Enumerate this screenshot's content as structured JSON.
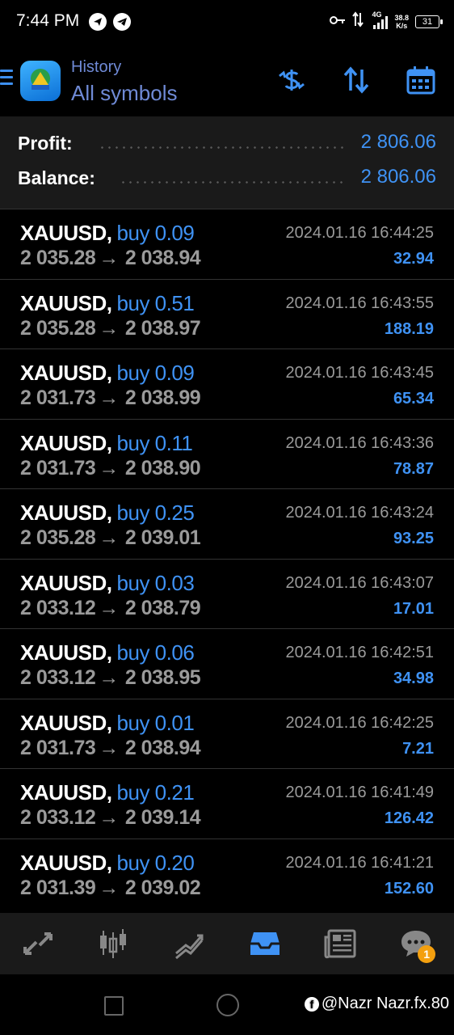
{
  "status_bar": {
    "time": "7:44 PM",
    "network": "4G",
    "speed_value": "38.8",
    "speed_unit": "K/s",
    "battery": "31"
  },
  "header": {
    "subtitle": "History",
    "title": "All symbols"
  },
  "summary": {
    "profit_label": "Profit:",
    "profit_value": "2 806.06",
    "balance_label": "Balance:",
    "balance_value": "2 806.06"
  },
  "trades": [
    {
      "symbol": "XAUUSD",
      "side": "buy 0.09",
      "open_price": "2 035.28",
      "close_price": "2 038.94",
      "time": "2024.01.16 16:44:25",
      "profit": "32.94"
    },
    {
      "symbol": "XAUUSD",
      "side": "buy 0.51",
      "open_price": "2 035.28",
      "close_price": "2 038.97",
      "time": "2024.01.16 16:43:55",
      "profit": "188.19"
    },
    {
      "symbol": "XAUUSD",
      "side": "buy 0.09",
      "open_price": "2 031.73",
      "close_price": "2 038.99",
      "time": "2024.01.16 16:43:45",
      "profit": "65.34"
    },
    {
      "symbol": "XAUUSD",
      "side": "buy 0.11",
      "open_price": "2 031.73",
      "close_price": "2 038.90",
      "time": "2024.01.16 16:43:36",
      "profit": "78.87"
    },
    {
      "symbol": "XAUUSD",
      "side": "buy 0.25",
      "open_price": "2 035.28",
      "close_price": "2 039.01",
      "time": "2024.01.16 16:43:24",
      "profit": "93.25"
    },
    {
      "symbol": "XAUUSD",
      "side": "buy 0.03",
      "open_price": "2 033.12",
      "close_price": "2 038.79",
      "time": "2024.01.16 16:43:07",
      "profit": "17.01"
    },
    {
      "symbol": "XAUUSD",
      "side": "buy 0.06",
      "open_price": "2 033.12",
      "close_price": "2 038.95",
      "time": "2024.01.16 16:42:51",
      "profit": "34.98"
    },
    {
      "symbol": "XAUUSD",
      "side": "buy 0.01",
      "open_price": "2 031.73",
      "close_price": "2 038.94",
      "time": "2024.01.16 16:42:25",
      "profit": "7.21"
    },
    {
      "symbol": "XAUUSD",
      "side": "buy 0.21",
      "open_price": "2 033.12",
      "close_price": "2 039.14",
      "time": "2024.01.16 16:41:49",
      "profit": "126.42"
    },
    {
      "symbol": "XAUUSD",
      "side": "buy 0.20",
      "open_price": "2 031.39",
      "close_price": "2 039.02",
      "time": "2024.01.16 16:41:21",
      "profit": "152.60"
    }
  ],
  "trade_arrow": "→",
  "bottom_nav": {
    "items": [
      "quotes-icon",
      "chart-icon",
      "trade-icon",
      "history-icon",
      "news-icon",
      "chat-icon"
    ],
    "active": "history-icon",
    "chat_badge": "1"
  },
  "watermark": {
    "text": "@Nazr Nazr.fx.80",
    "icon": "facebook-icon"
  },
  "colors": {
    "accent": "#3f92f4",
    "header_text": "#6f8ad6",
    "muted": "#9a9a9a",
    "badge": "#f4a00f"
  }
}
